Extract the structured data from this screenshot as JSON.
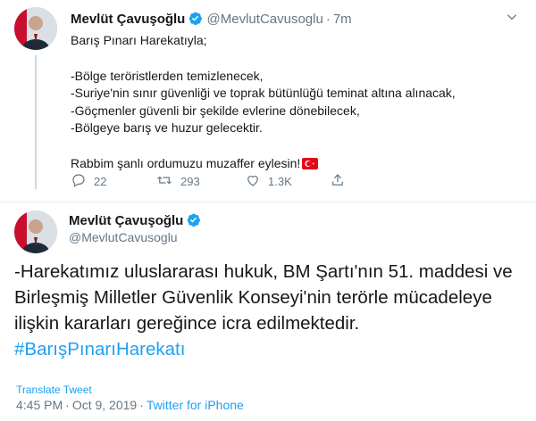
{
  "colors": {
    "link": "#1da1f2",
    "muted": "#657786",
    "text": "#14171a",
    "divider": "#e6ecf0"
  },
  "tweet1": {
    "author_name": "Mevlüt Çavuşoğlu",
    "author_handle": "@MevlutCavusoglu",
    "time": "7m",
    "lines": [
      "Barış Pınarı Harekatıyla;",
      "-Bölge teröristlerden temizlenecek,",
      "-Suriye'nin sınır güvenliği ve toprak bütünlüğü teminat altına alınacak,",
      "-Göçmenler güvenli bir şekilde evlerine dönebilecek,",
      "-Bölgeye barış ve huzur gelecektir.",
      "Rabbim şanlı ordumuzu muzaffer eylesin!"
    ],
    "flag_icon": "turkey-flag-icon",
    "replies": "22",
    "retweets": "293",
    "likes": "1.3K"
  },
  "tweet2": {
    "author_name": "Mevlüt Çavuşoğlu",
    "author_handle": "@MevlutCavusoglu",
    "text": "-Harekatımız uluslararası hukuk, BM Şartı'nın 51. maddesi ve Birleşmiş Milletler Güvenlik Konseyi'nin terörle mücadeleye ilişkin kararları gereğince icra edilmektedir.",
    "hashtag": "#BarışPınarıHarekatı",
    "translate_label": "Translate Tweet",
    "timestamp_time": "4:45 PM",
    "timestamp_date": "Oct 9, 2019",
    "source": "Twitter for iPhone"
  }
}
